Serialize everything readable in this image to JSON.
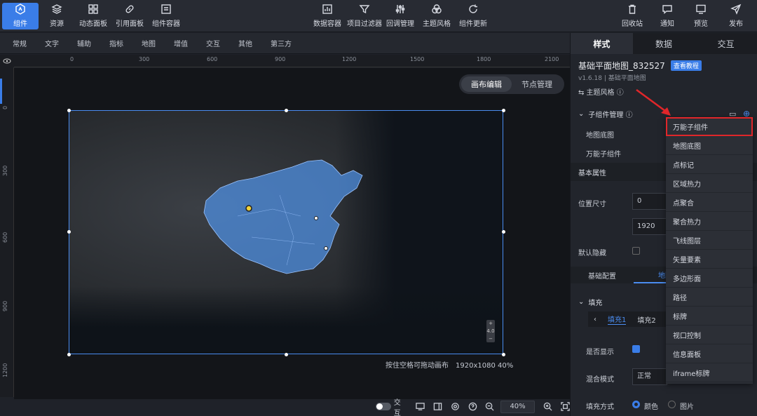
{
  "toolbar": {
    "left": [
      {
        "label": "组件",
        "icon": "component-icon",
        "active": true
      },
      {
        "label": "资源",
        "icon": "layers-icon"
      },
      {
        "label": "动态面板",
        "icon": "grid-icon"
      },
      {
        "label": "引用面板",
        "icon": "link-icon"
      },
      {
        "label": "组件容器",
        "icon": "container-icon"
      }
    ],
    "center": [
      {
        "label": "数据容器",
        "icon": "data-container-icon"
      },
      {
        "label": "项目过滤器",
        "icon": "filter-icon"
      },
      {
        "label": "回调管理",
        "icon": "sliders-icon"
      },
      {
        "label": "主题风格",
        "icon": "palette-icon"
      },
      {
        "label": "组件更新",
        "icon": "refresh-icon"
      }
    ],
    "right": [
      {
        "label": "回收站",
        "icon": "trash-icon"
      },
      {
        "label": "通知",
        "icon": "message-icon"
      },
      {
        "label": "预览",
        "icon": "preview-icon"
      },
      {
        "label": "发布",
        "icon": "send-icon"
      }
    ]
  },
  "categories": [
    "常规",
    "文字",
    "辅助",
    "指标",
    "地图",
    "增值",
    "交互",
    "其他",
    "第三方"
  ],
  "ruler_top": [
    "0",
    "300",
    "600",
    "900",
    "1200",
    "1500",
    "1800",
    "2100"
  ],
  "ruler_left": [
    "0",
    "300",
    "600",
    "900",
    "1200"
  ],
  "canvas": {
    "mode_tabs": [
      "画布编辑",
      "节点管理"
    ],
    "hint": "按住空格可拖动画布",
    "size": "1920x1080 40%"
  },
  "bottom": {
    "interact_label": "交互",
    "zoom": "40%"
  },
  "panel": {
    "tabs": [
      "样式",
      "数据",
      "交互"
    ],
    "component_name": "基础平面地图_832527",
    "tutorial": "查看教程",
    "version": "v1.6.18 | 基础平面地图",
    "theme_style": "⇆ 主题风格 ⓘ",
    "child_manage": "子组件管理 ⓘ",
    "children": [
      "地图底图",
      "万能子组件"
    ],
    "basic_props": "基本属性",
    "position_size": "位置尺寸",
    "pos_x": "0",
    "width": "1920",
    "default_hidden": "默认隐藏",
    "subtabs": [
      "基础配置",
      "地图"
    ],
    "fill": "填充",
    "fill_tabs": [
      "填充1",
      "填充2"
    ],
    "is_show": "是否显示",
    "blend_mode": "混合模式",
    "blend_value": "正常",
    "fill_method": "填充方式",
    "fill_color": "颜色",
    "fill_image": "图片"
  },
  "dropdown": [
    "万能子组件",
    "地图底图",
    "点标记",
    "区域热力",
    "点聚合",
    "聚合热力",
    "飞线图层",
    "矢量要素",
    "多边形面",
    "路径",
    "标牌",
    "视口控制",
    "信息面板",
    "iframe标牌"
  ],
  "colors": {
    "accent": "#3a7de8",
    "highlight": "#e0262a",
    "china_fill": "#4f8fe0"
  }
}
